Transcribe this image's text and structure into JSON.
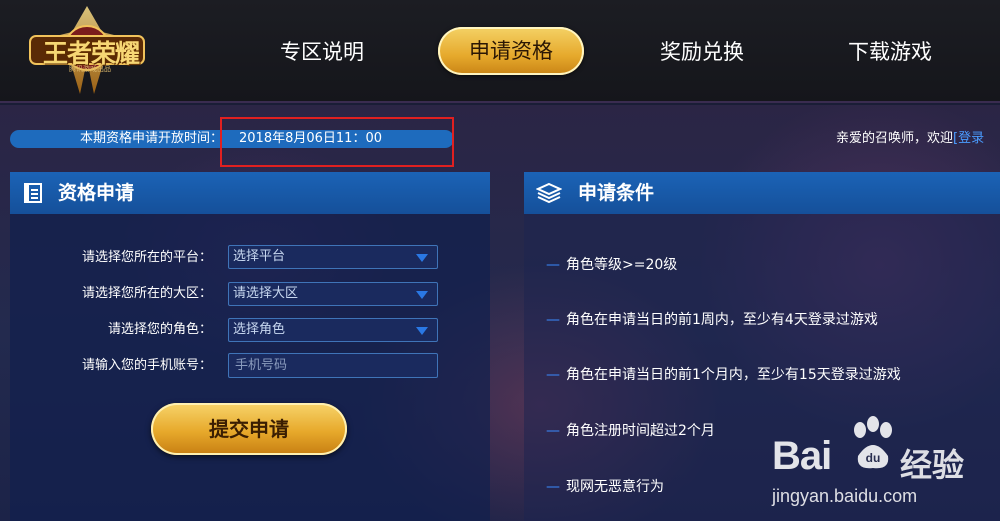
{
  "header": {
    "logo_text": "王者荣耀",
    "logo_sub": "腾讯游戏出品",
    "nav": [
      {
        "label": "专区说明"
      },
      {
        "label": "申请资格"
      },
      {
        "label": "奖励兑换"
      },
      {
        "label": "下载游戏"
      }
    ],
    "active_nav_index": 1
  },
  "infobar": {
    "label": "本期资格申请开放时间：",
    "time": "2018年8月06日11：00"
  },
  "welcome": {
    "text": "亲爱的召唤师，欢迎",
    "link": "[登录"
  },
  "form_panel": {
    "title": "资格申请",
    "icon": "document-icon",
    "fields": [
      {
        "label": "请选择您所在的平台：",
        "value": "选择平台"
      },
      {
        "label": "请选择您所在的大区：",
        "value": "请选择大区"
      },
      {
        "label": "请选择您的角色：",
        "value": "选择角色"
      }
    ],
    "phone": {
      "label": "请输入您的手机账号：",
      "placeholder": "手机号码"
    },
    "submit_label": "提交申请"
  },
  "conditions_panel": {
    "title": "申请条件",
    "icon": "layers-icon",
    "items": [
      "角色等级>=20级",
      "角色在申请当日的前1周内，至少有4天登录过游戏",
      "角色在申请当日的前1个月内，至少有15天登录过游戏",
      "角色注册时间超过2个月",
      "现网无恶意行为"
    ]
  },
  "watermark": {
    "brand_left": "Bai",
    "brand_right": "经验",
    "url": "jingyan.baidu.com"
  },
  "colors": {
    "accent_gold": "#e6a92c",
    "panel_blue": "#1b63b6",
    "highlight_red": "#e02020",
    "link_blue": "#4a9cff"
  }
}
